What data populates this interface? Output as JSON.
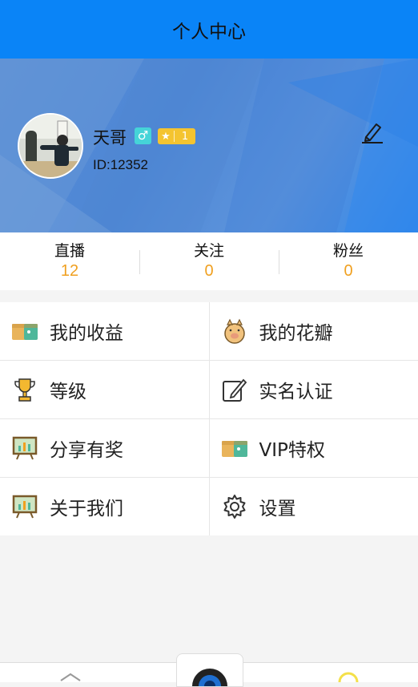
{
  "header": {
    "title": "个人中心"
  },
  "profile": {
    "name": "天哥",
    "gender_symbol": "♂",
    "level_star": "★",
    "level": "1",
    "id_text": "ID:12352"
  },
  "stats": [
    {
      "label": "直播",
      "value": "12"
    },
    {
      "label": "关注",
      "value": "0"
    },
    {
      "label": "粉丝",
      "value": "0"
    }
  ],
  "menu": [
    {
      "label": "我的收益",
      "icon": "wallet-icon"
    },
    {
      "label": "我的花瓣",
      "icon": "piggy-bank-icon"
    },
    {
      "label": "等级",
      "icon": "trophy-icon"
    },
    {
      "label": "实名认证",
      "icon": "edit-document-icon"
    },
    {
      "label": "分享有奖",
      "icon": "presentation-board-icon"
    },
    {
      "label": "VIP特权",
      "icon": "wallet-icon"
    },
    {
      "label": "关于我们",
      "icon": "presentation-board-icon"
    },
    {
      "label": "设置",
      "icon": "gear-icon"
    }
  ],
  "colors": {
    "header_bg": "#0a84f7",
    "stat_value": "#f0a020",
    "gender_badge": "#45d4d8",
    "level_badge": "#f4c430"
  }
}
